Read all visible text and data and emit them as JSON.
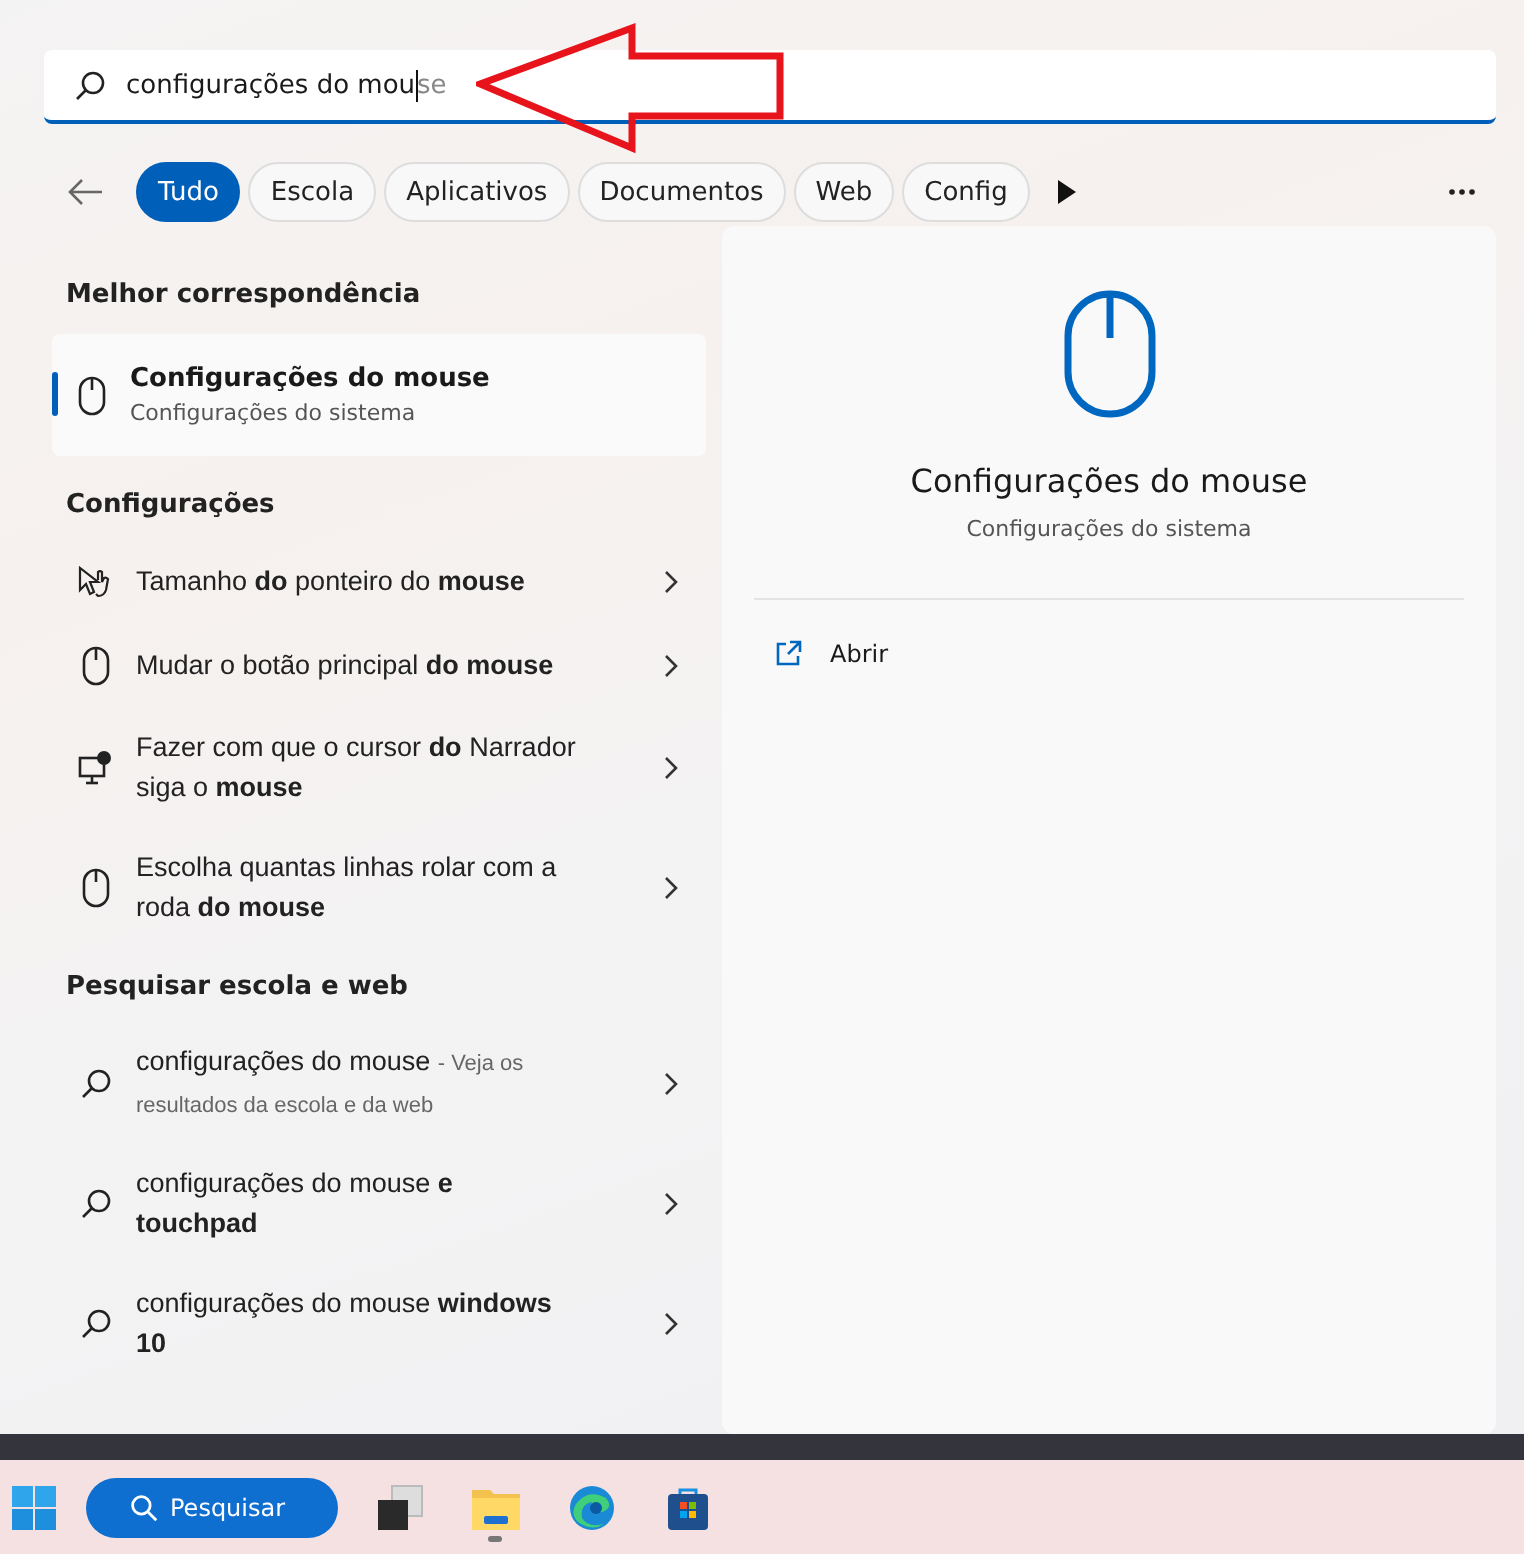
{
  "search": {
    "value": "configurações do mou",
    "suggestion": "se"
  },
  "filters": [
    {
      "label": "Tudo",
      "selected": true
    },
    {
      "label": "Escola",
      "selected": false
    },
    {
      "label": "Aplicativos",
      "selected": false
    },
    {
      "label": "Documentos",
      "selected": false
    },
    {
      "label": "Web",
      "selected": false
    },
    {
      "label": "Config",
      "selected": false
    }
  ],
  "best_match": {
    "heading": "Melhor correspondência",
    "title": "Configurações do mouse",
    "subtitle": "Configurações do sistema",
    "selected": true
  },
  "settings": {
    "heading": "Configurações",
    "items": [
      {
        "kind": "pointer",
        "text": "Tamanho **do** ponteiro do **mouse**"
      },
      {
        "kind": "mouse",
        "text": "Mudar o botão principal **do mouse**"
      },
      {
        "kind": "narrator",
        "text": "Fazer com que o cursor **do** Narrador siga o **mouse**"
      },
      {
        "kind": "mouse",
        "text": "Escolha quantas linhas rolar com a roda **do mouse**"
      }
    ]
  },
  "web": {
    "heading": "Pesquisar escola e web",
    "items": [
      {
        "text": "configurações do mouse",
        "note": "- Veja os resultados da escola e da web"
      },
      {
        "text": "configurações do mouse **e touchpad**"
      },
      {
        "text": "configurações do mouse **windows 10**"
      }
    ]
  },
  "preview": {
    "title": "Configurações do mouse",
    "subtitle": "Configurações do sistema",
    "actions": [
      {
        "label": "Abrir"
      }
    ]
  },
  "taskbar": {
    "search_label": "Pesquisar",
    "apps": [
      {
        "kind": "taskview",
        "running": false
      },
      {
        "kind": "explorer",
        "running": true
      },
      {
        "kind": "edge",
        "running": false
      },
      {
        "kind": "store",
        "running": false
      }
    ]
  }
}
